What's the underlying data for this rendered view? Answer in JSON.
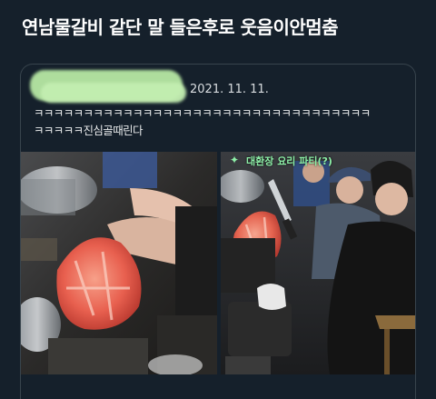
{
  "post": {
    "title": "연남물갈비 같단 말 들은후로 웃음이안멈춤"
  },
  "quote": {
    "author_redacted": true,
    "date": "2021. 11. 11.",
    "text_line1": "ㅋㅋㅋㅋㅋㅋㅋㅋㅋㅋㅋㅋㅋㅋㅋㅋㅋㅋㅋㅋㅋㅋㅋㅋㅋㅋㅋㅋㅋㅋㅋㅋㅋㅋ",
    "text_line2": "ㅋㅋㅋㅋㅋ진심골때린다"
  },
  "media": {
    "left_description_icon": "photo",
    "right_overlay_label": "대환장 요리 파티(?)",
    "right_overlay_icon": "sparkle-icon"
  },
  "colors": {
    "background": "#15202b",
    "border": "#38444d",
    "overlay_text": "#8ef0a8",
    "redaction": "#b7e8a4"
  }
}
